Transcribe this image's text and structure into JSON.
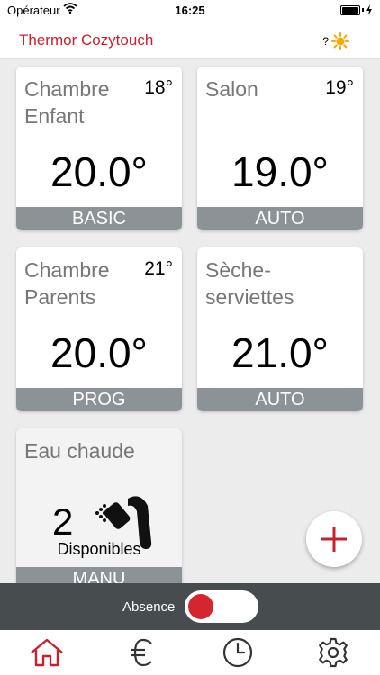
{
  "status_bar": {
    "carrier": "Opérateur",
    "time": "16:25"
  },
  "header": {
    "title": "Thermor Cozytouch",
    "weather_mark": "?",
    "weather_icon": "sun-icon"
  },
  "devices": [
    {
      "name": "Chambre Enfant",
      "setpoint": "18°",
      "temperature": "20.0°",
      "mode": "BASIC"
    },
    {
      "name": "Salon",
      "setpoint": "19°",
      "temperature": "19.0°",
      "mode": "AUTO"
    },
    {
      "name": "Chambre Parents",
      "setpoint": "21°",
      "temperature": "20.0°",
      "mode": "PROG"
    },
    {
      "name": "Sèche-serviettes",
      "setpoint": "",
      "temperature": "21.0°",
      "mode": "AUTO"
    }
  ],
  "water_heater": {
    "name": "Eau chaude",
    "count": "2",
    "label": "Disponibles",
    "mode": "MANU",
    "icon": "shower-icon"
  },
  "fab": {
    "icon": "plus-icon"
  },
  "absence": {
    "label": "Absence",
    "enabled": false
  },
  "tabs": [
    {
      "name": "home",
      "icon": "home-icon",
      "active": true
    },
    {
      "name": "cost",
      "icon": "euro-icon",
      "active": false
    },
    {
      "name": "schedule",
      "icon": "clock-icon",
      "active": false
    },
    {
      "name": "settings",
      "icon": "gear-icon",
      "active": false
    }
  ],
  "colors": {
    "accent": "#c8202f",
    "mode_bar": "#8c9396",
    "absence_bar": "#474c4f",
    "background": "#ececec"
  }
}
